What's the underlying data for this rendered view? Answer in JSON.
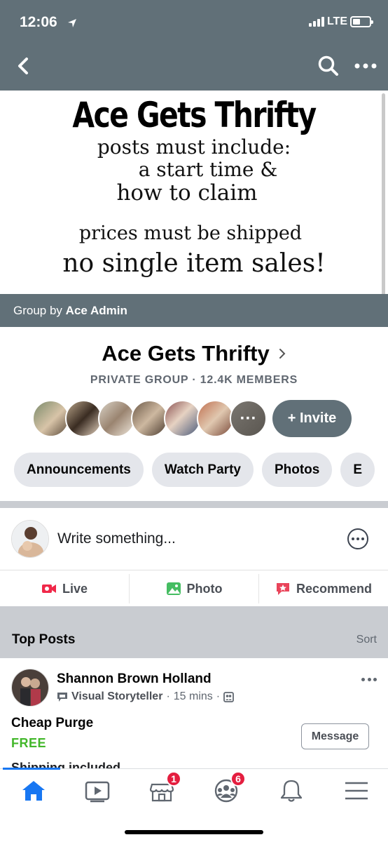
{
  "status_bar": {
    "time": "12:06",
    "carrier": "LTE"
  },
  "cover": {
    "title": "Ace Gets Thrifty",
    "lines": [
      "posts must include:",
      "a start time &",
      "how to claim",
      "prices must be shipped",
      "no single item sales!"
    ],
    "group_by_prefix": "Group by",
    "group_by_admin": "Ace Admin"
  },
  "group": {
    "name": "Ace Gets Thrifty",
    "meta": "PRIVATE GROUP · 12.4K MEMBERS",
    "invite_label": "+ Invite",
    "more_members": "···"
  },
  "tabs": [
    "Announcements",
    "Watch Party",
    "Photos",
    "E"
  ],
  "composer": {
    "placeholder": "Write something...",
    "actions": [
      "Live",
      "Photo",
      "Recommend"
    ]
  },
  "section": {
    "title": "Top Posts",
    "sort_label": "Sort"
  },
  "post": {
    "author": "Shannon Brown Holland",
    "badge": "Visual Storyteller",
    "time": "15 mins",
    "title": "Cheap Purge",
    "price": "FREE",
    "message_label": "Message",
    "cut_text": "Shipping included"
  },
  "bottom_nav": {
    "items": [
      "home-icon",
      "watch-icon",
      "marketplace-icon",
      "groups-icon",
      "notifications-icon",
      "menu-icon"
    ],
    "marketplace_badge": "1",
    "groups_badge": "6"
  },
  "colors": {
    "header": "#617078",
    "accent": "#1877f2",
    "badge": "#e41e3f",
    "price": "#42b72a"
  }
}
